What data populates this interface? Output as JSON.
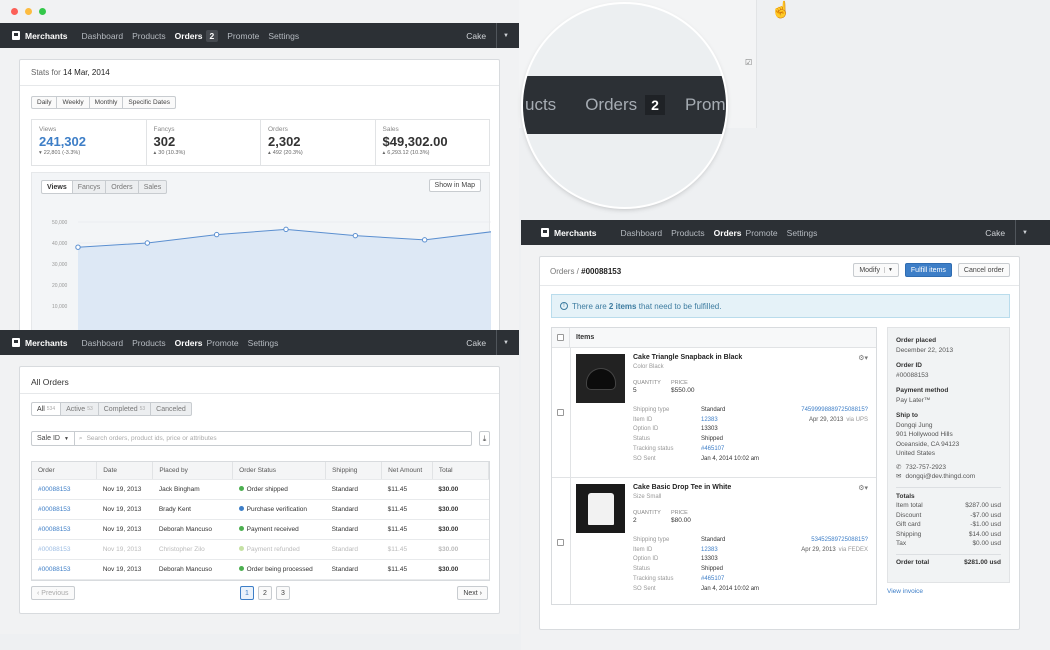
{
  "brand": "Merchants",
  "nav_items": [
    "Dashboard",
    "Products",
    "Orders",
    "Promote",
    "Settings"
  ],
  "user": "Cake",
  "orders_badge": "2",
  "stats": {
    "title_prefix": "Stats for",
    "date": "14 Mar, 2014",
    "ranges": [
      "Daily",
      "Weekly",
      "Monthly",
      "Specific Dates"
    ],
    "metrics": [
      {
        "label": "Views",
        "value": "241,302",
        "change": "22,801 (-3.3%)",
        "dir": "down",
        "highlight": true
      },
      {
        "label": "Fancys",
        "value": "302",
        "change": "30 (10.3%)",
        "dir": "up",
        "highlight": false
      },
      {
        "label": "Orders",
        "value": "2,302",
        "change": "492 (20.3%)",
        "dir": "up",
        "highlight": false
      },
      {
        "label": "Sales",
        "value": "$49,302.00",
        "change": "6,293.12 (10.3%)",
        "dir": "up",
        "highlight": false
      }
    ],
    "tabs": [
      "Views",
      "Fancys",
      "Orders",
      "Sales"
    ],
    "map_button": "Show in Map"
  },
  "chart_data": {
    "type": "area",
    "y_ticks": [
      "50,000",
      "40,000",
      "30,000",
      "20,000",
      "10,000"
    ],
    "ylim": [
      0,
      50000
    ],
    "values": [
      38000,
      40000,
      44000,
      46500,
      43500,
      41500,
      45500
    ],
    "color": "#5b8fd0"
  },
  "all_orders": {
    "title": "All Orders",
    "filters": [
      {
        "label": "All",
        "count": "534"
      },
      {
        "label": "Active",
        "count": "53"
      },
      {
        "label": "Completed",
        "count": "53"
      },
      {
        "label": "Canceled",
        "count": ""
      }
    ],
    "search_select": "Sale ID",
    "search_placeholder": "Search orders, product ids, price or attributes",
    "columns": [
      "Order",
      "Date",
      "Placed by",
      "Order Status",
      "Shipping",
      "Net Amount",
      "Total"
    ],
    "rows": [
      {
        "order": "#00088153",
        "date": "Nov 19, 2013",
        "by": "Jack Bingham",
        "status": "Order shipped",
        "status_color": "#4caf50",
        "shipping": "Standard",
        "net": "$11.45",
        "total": "$30.00",
        "faded": false
      },
      {
        "order": "#00088153",
        "date": "Nov 19, 2013",
        "by": "Brady Kent",
        "status": "Purchase verification",
        "status_color": "#3d7ec7",
        "shipping": "Standard",
        "net": "$11.45",
        "total": "$30.00",
        "faded": false
      },
      {
        "order": "#00088153",
        "date": "Nov 19, 2013",
        "by": "Deborah Mancuso",
        "status": "Payment received",
        "status_color": "#4caf50",
        "shipping": "Standard",
        "net": "$11.45",
        "total": "$30.00",
        "faded": false
      },
      {
        "order": "#00088153",
        "date": "Nov 19, 2013",
        "by": "Christopher Zilo",
        "status": "Payment refunded",
        "status_color": "#8bc34a",
        "shipping": "Standard",
        "net": "$11.45",
        "total": "$30.00",
        "faded": true
      },
      {
        "order": "#00088153",
        "date": "Nov 19, 2013",
        "by": "Deborah Mancuso",
        "status": "Order being processed",
        "status_color": "#4caf50",
        "shipping": "Standard",
        "net": "$11.45",
        "total": "$30.00",
        "faded": false
      }
    ],
    "prev": "‹ Previous",
    "next": "Next ›",
    "pages": [
      "1",
      "2",
      "3"
    ]
  },
  "zoom": {
    "left_text": "ucts",
    "orders": "Orders",
    "badge": "2",
    "right_text": "Prom"
  },
  "order": {
    "breadcrumb_root": "Orders /",
    "id": "#00088153",
    "modify": "Modify",
    "fulfill": "Fulfill items",
    "cancel": "Cancel order",
    "notice_pre": "There are",
    "notice_bold": "2 items",
    "notice_post": "that need to be fulfilled.",
    "items_header": "Items",
    "items": [
      {
        "name": "Cake Triangle Snapback in Black",
        "variant": "Color Black",
        "qty_label": "Quantity",
        "qty": "5",
        "price_label": "Price",
        "price": "$550.00",
        "details": [
          [
            "Shipping type",
            "Standard"
          ],
          [
            "Item ID",
            "12383"
          ],
          [
            "Option ID",
            "13303"
          ],
          [
            "Status",
            "Shipped"
          ],
          [
            "Tracking status",
            "#465107"
          ],
          [
            "SO Sent",
            "Jan 4, 2014 10:02 am"
          ]
        ],
        "tracking": "7459999888972508815?",
        "ship_date": "Apr 29, 2013",
        "via": "via UPS"
      },
      {
        "name": "Cake Basic Drop Tee in White",
        "variant": "Size Small",
        "qty_label": "Quantity",
        "qty": "2",
        "price_label": "Price",
        "price": "$80.00",
        "details": [
          [
            "Shipping type",
            "Standard"
          ],
          [
            "Item ID",
            "12383"
          ],
          [
            "Option ID",
            "13303"
          ],
          [
            "Status",
            "Shipped"
          ],
          [
            "Tracking status",
            "#465107"
          ],
          [
            "SO Sent",
            "Jan 4, 2014 10:02 am"
          ]
        ],
        "tracking": "5345258972508815?",
        "ship_date": "Apr 29, 2013",
        "via": "via FEDEX"
      }
    ],
    "side": {
      "placed_label": "Order placed",
      "placed": "December 22, 2013",
      "id_label": "Order ID",
      "id": "#00088153",
      "payment_label": "Payment method",
      "payment": "Pay Later™",
      "ship_label": "Ship to",
      "ship": [
        "Dongqi Jung",
        "901 Hollywood Hills",
        "Oceanside, CA 94123",
        "United States"
      ],
      "phone": "732-757-2923",
      "email": "dongqi@dev.thingd.com",
      "totals_label": "Totals",
      "totals": [
        [
          "Item total",
          "$287.00 usd"
        ],
        [
          "Discount",
          "-$7.00 usd"
        ],
        [
          "Gift card",
          "-$1.00 usd"
        ],
        [
          "Shipping",
          "$14.00 usd"
        ],
        [
          "Tax",
          "$0.00 usd"
        ]
      ],
      "order_total_label": "Order total",
      "order_total": "$281.00 usd",
      "invoice": "View invoice"
    }
  }
}
